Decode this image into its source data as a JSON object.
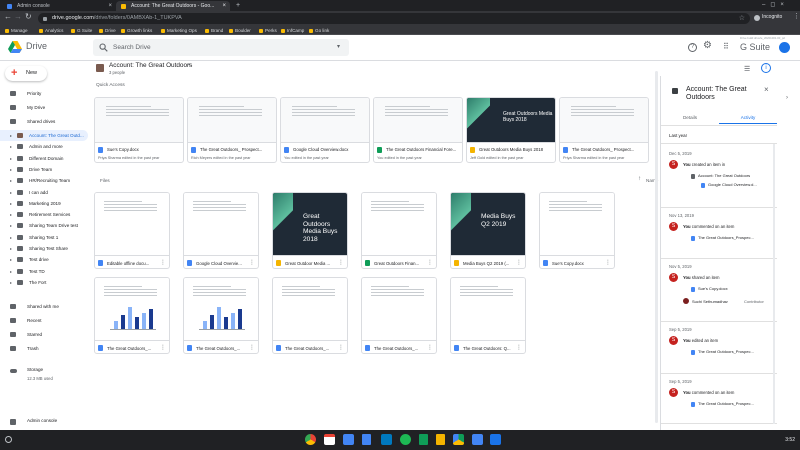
{
  "browser": {
    "tabs": [
      {
        "label": "Admin console",
        "active": false,
        "color": "#4285f4"
      },
      {
        "label": "Account: The Great Outdoors - Goo...",
        "active": true,
        "color": "#fbbc04"
      }
    ],
    "new_tab": "+",
    "url": "drive.google.com/drive/folders/0AMBXAb-1_TUKPVA",
    "url_host": "drive.google.com",
    "url_path": "/drive/folders/0AMBXAb-1_TUKPVA",
    "incognito_label": "Incognito",
    "bookmarks": [
      "Manage",
      "Analytics",
      "G Suite",
      "Drive",
      "Growth links",
      "Marketing Ops",
      "Brand",
      "Boulder",
      "Perks",
      "InfCamp",
      "Go link"
    ]
  },
  "drive": {
    "logo_label": "Drive",
    "search_placeholder": "Search Drive",
    "gsuite_label": "G Suite",
    "new_button": "New",
    "build_label": "Drive build:drivefe_20201001.00_p2"
  },
  "sidebar": {
    "nav": [
      {
        "label": "Priority"
      },
      {
        "label": "My Drive"
      },
      {
        "label": "Shared drives"
      }
    ],
    "shared_drives": [
      {
        "label": "Account: The Great Outd...",
        "selected": true
      },
      {
        "label": "Admin and more"
      },
      {
        "label": "Different Domain"
      },
      {
        "label": "Drive Team"
      },
      {
        "label": "HR/Recruiting Team"
      },
      {
        "label": "I can add"
      },
      {
        "label": "Marketing 2019"
      },
      {
        "label": "Retirement Services"
      },
      {
        "label": "Sharing Team Drive test"
      },
      {
        "label": "Sharing Test 1"
      },
      {
        "label": "Sharing Test Share"
      },
      {
        "label": "Test drive"
      },
      {
        "label": "Test TD"
      },
      {
        "label": "The Fort"
      }
    ],
    "bottom": [
      {
        "label": "Shared with me"
      },
      {
        "label": "Recent"
      },
      {
        "label": "Starred"
      },
      {
        "label": "Trash"
      }
    ],
    "storage_label": "Storage",
    "storage_used": "12.3 MB used",
    "admin_console": "Admin console"
  },
  "main": {
    "drive_title": "Account: The Great Outdoors",
    "people": "3 people",
    "quick_access_label": "Quick Access",
    "quick_access": [
      {
        "name": "Sue's Copy.docx",
        "sub": "Priya Sharma edited in the past year",
        "type": "doc",
        "dark": false
      },
      {
        "name": "The Great Outdoors_ Prospect...",
        "sub": "Rich Meyers edited in the past year",
        "type": "doc",
        "dark": false
      },
      {
        "name": "Google Cloud Overview.docx",
        "sub": "You edited in the past year",
        "type": "doc",
        "dark": false
      },
      {
        "name": "The Great Outdoors Financial Fore...",
        "sub": "You edited in the past year",
        "type": "sheet",
        "dark": false
      },
      {
        "name": "Great Outdoors Media Buys 2018",
        "sub": "Jeff Gold edited in the past year",
        "type": "slide",
        "dark": true,
        "thumb_text": "Great Outdoors Media Buys 2018"
      },
      {
        "name": "The Great Outdoors_ Prospect...",
        "sub": "Priya Sharma edited in the past year",
        "type": "doc",
        "dark": false
      }
    ],
    "files_label": "Files",
    "sort_label": "Name",
    "files": [
      {
        "name": "Editable offline docu...",
        "type": "doc",
        "dark": false,
        "chart": false
      },
      {
        "name": "Google Cloud Overvie...",
        "type": "doc",
        "dark": false,
        "chart": false
      },
      {
        "name": "Great Outdoor Media ...",
        "type": "slide",
        "dark": true,
        "chart": false,
        "thumb_text": "Great Outdoors Media Buys 2018"
      },
      {
        "name": "Great Outdoors Finan...",
        "type": "sheet",
        "dark": false,
        "chart": false
      },
      {
        "name": "Media Buys Q2 2019 (...",
        "type": "slide",
        "dark": true,
        "chart": false,
        "thumb_text": "Media Buys Q2 2019"
      },
      {
        "name": "Sue's Copy.docx",
        "type": "doc",
        "dark": false,
        "chart": false
      },
      {
        "name": "The Great Outdoors_...",
        "type": "doc",
        "dark": false,
        "chart": true
      },
      {
        "name": "The Great Outdoors_...",
        "type": "doc",
        "dark": false,
        "chart": true
      },
      {
        "name": "The Great Outdoors_...",
        "type": "doc",
        "dark": false,
        "chart": false
      },
      {
        "name": "The Great Outdoors_...",
        "type": "doc",
        "dark": false,
        "chart": false
      },
      {
        "name": "The Great Outdoors: Q...",
        "type": "doc",
        "dark": false,
        "chart": false
      }
    ]
  },
  "details": {
    "title": "Account: The Great Outdoors",
    "tabs": [
      "Details",
      "Activity"
    ],
    "active_tab": "Activity",
    "period": "Last year",
    "activity": [
      {
        "date": "Dec 5, 2019",
        "actor": "You",
        "action": "created an item in",
        "items": [
          "Account: The Great Outdoors",
          "Google Cloud Overview.d..."
        ]
      },
      {
        "date": "Nov 13, 2019",
        "actor": "You",
        "action": "commented on an item",
        "items": [
          "The Great Outdoors_Prospec..."
        ]
      },
      {
        "date": "Nov 5, 2019",
        "actor": "You",
        "action": "shared an item",
        "items": [
          "Sue's Copy.docx"
        ],
        "person": "Suchi Sethumadhav",
        "role": "Contributor"
      },
      {
        "date": "Sep 5, 2019",
        "actor": "You",
        "action": "edited an item",
        "items": [
          "The Great Outdoors_Prospec..."
        ]
      },
      {
        "date": "Sep 5, 2019",
        "actor": "You",
        "action": "commented on an item",
        "items": [
          "The Great Outdoors_Prospec..."
        ]
      }
    ]
  },
  "shelf": {
    "time": "3:52"
  },
  "colors": {
    "doc": "#4285f4",
    "sheet": "#0f9d58",
    "slide": "#f4b400",
    "accent": "#1a73e8",
    "avatar": "#c5221f"
  }
}
